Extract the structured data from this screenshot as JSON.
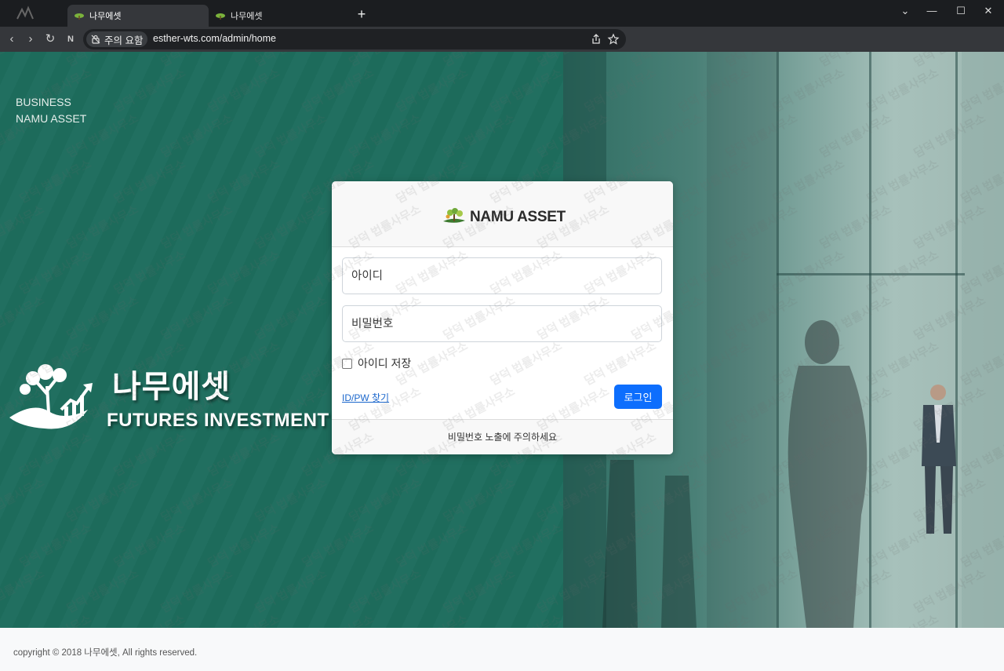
{
  "browser": {
    "tabs": [
      {
        "title": "나무에셋",
        "active": true
      },
      {
        "title": "나무에셋",
        "active": false
      }
    ],
    "new_tab_icon": "plus-icon",
    "security_label": "주의 요함",
    "url": "esther-wts.com/admin/home"
  },
  "hero": {
    "top_line1": "BUSINESS",
    "top_line2": "NAMU ASSET",
    "brand_ko": "나무에셋",
    "brand_en": "FUTURES INVESTMENT"
  },
  "login": {
    "title": "NAMU ASSET",
    "id_placeholder": "아이디",
    "pw_placeholder": "비밀번호",
    "remember_label": "아이디 저장",
    "remember_checked": false,
    "find_link": "ID/PW 찾기",
    "submit_label": "로그인",
    "notice": "비밀번호 노출에 주의하세요"
  },
  "watermark": {
    "text": "담덕 법률사무소"
  },
  "footer": {
    "copyright": "copyright © 2018 나무에셋, All rights reserved."
  },
  "colors": {
    "primary": "#0d6efd",
    "brand_green": "#1d6b5b",
    "link": "#1a66cc"
  }
}
